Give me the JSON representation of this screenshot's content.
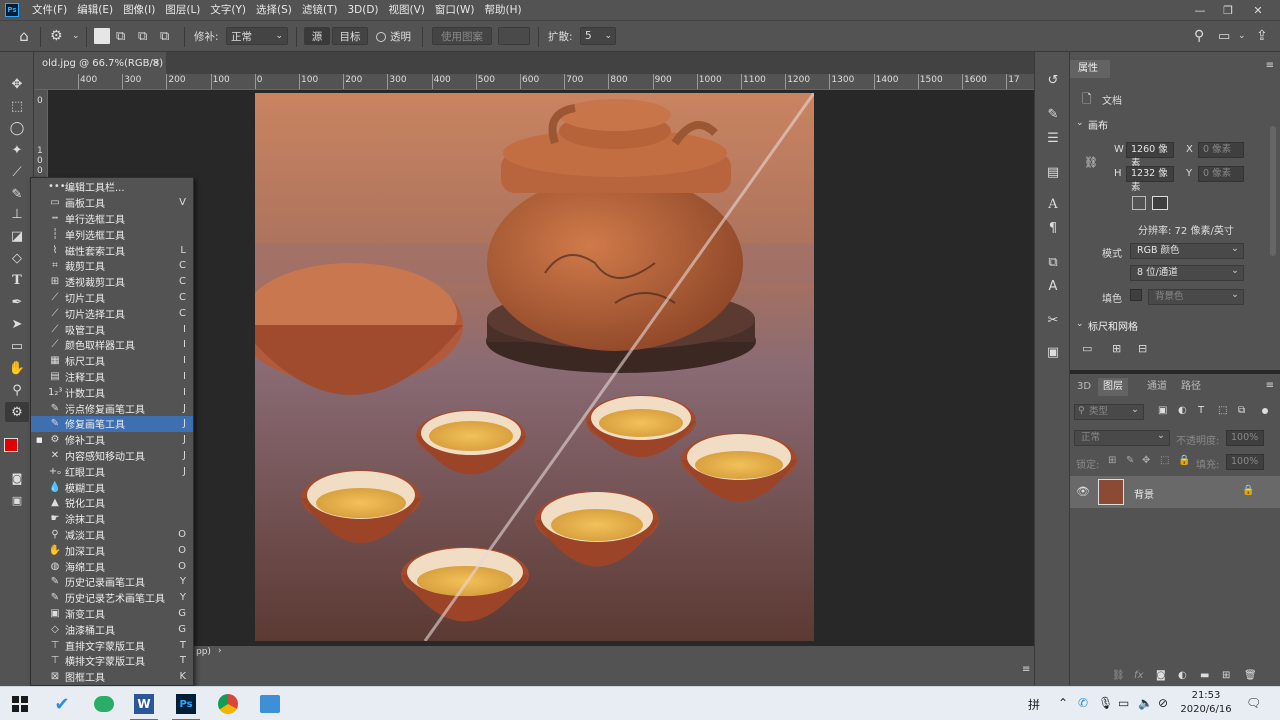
{
  "menubar": {
    "logo": "Ps",
    "items": [
      "文件(F)",
      "编辑(E)",
      "图像(I)",
      "图层(L)",
      "文字(Y)",
      "选择(S)",
      "滤镜(T)",
      "3D(D)",
      "视图(V)",
      "窗口(W)",
      "帮助(H)"
    ]
  },
  "options": {
    "patch_label": "修补:",
    "patch_mode": "正常",
    "source_label": "源",
    "target_label": "目标",
    "transparent_label": "透明",
    "use_pattern_label": "使用图案",
    "diffusion_label": "扩散:",
    "diffusion_value": "5"
  },
  "document": {
    "tab_title": "old.jpg @ 66.7%(RGB/8)",
    "zoom_status": "pp)"
  },
  "ruler": {
    "h_labels": [
      "400",
      "300",
      "200",
      "100",
      "0",
      "100",
      "200",
      "300",
      "400",
      "500",
      "600",
      "700",
      "800",
      "900",
      "1000",
      "1100",
      "1200",
      "1300",
      "1400",
      "1500",
      "1600",
      "17"
    ],
    "v_labels": [
      "0",
      "1",
      "0",
      "0"
    ]
  },
  "tool_flyout": {
    "items": [
      {
        "label": "编辑工具栏...",
        "key": "",
        "icon": "•••"
      },
      {
        "label": "画板工具",
        "key": "V",
        "icon": "▭"
      },
      {
        "label": "单行选框工具",
        "key": "",
        "icon": "┅"
      },
      {
        "label": "单列选框工具",
        "key": "",
        "icon": "┆"
      },
      {
        "label": "磁性套索工具",
        "key": "L",
        "icon": "⌇"
      },
      {
        "label": "裁剪工具",
        "key": "C",
        "icon": "⌗"
      },
      {
        "label": "透视裁剪工具",
        "key": "C",
        "icon": "⊞"
      },
      {
        "label": "切片工具",
        "key": "C",
        "icon": "⟋"
      },
      {
        "label": "切片选择工具",
        "key": "C",
        "icon": "⟋"
      },
      {
        "label": "吸管工具",
        "key": "I",
        "icon": "⟋"
      },
      {
        "label": "颜色取样器工具",
        "key": "I",
        "icon": "⟋"
      },
      {
        "label": "标尺工具",
        "key": "I",
        "icon": "▦"
      },
      {
        "label": "注释工具",
        "key": "I",
        "icon": "▤"
      },
      {
        "label": "计数工具",
        "key": "I",
        "icon": "1₂³"
      },
      {
        "label": "污点修复画笔工具",
        "key": "J",
        "icon": "✎"
      },
      {
        "label": "修复画笔工具",
        "key": "J",
        "icon": "✎"
      },
      {
        "label": "修补工具",
        "key": "J",
        "icon": "⚙"
      },
      {
        "label": "内容感知移动工具",
        "key": "J",
        "icon": "✕"
      },
      {
        "label": "红眼工具",
        "key": "J",
        "icon": "+ₒ"
      },
      {
        "label": "模糊工具",
        "key": "",
        "icon": "💧"
      },
      {
        "label": "锐化工具",
        "key": "",
        "icon": "▲"
      },
      {
        "label": "涂抹工具",
        "key": "",
        "icon": "☛"
      },
      {
        "label": "减淡工具",
        "key": "O",
        "icon": "⚲"
      },
      {
        "label": "加深工具",
        "key": "O",
        "icon": "✋"
      },
      {
        "label": "海绵工具",
        "key": "O",
        "icon": "◍"
      },
      {
        "label": "历史记录画笔工具",
        "key": "Y",
        "icon": "✎"
      },
      {
        "label": "历史记录艺术画笔工具",
        "key": "Y",
        "icon": "✎"
      },
      {
        "label": "渐变工具",
        "key": "G",
        "icon": "▣"
      },
      {
        "label": "油漆桶工具",
        "key": "G",
        "icon": "◇"
      },
      {
        "label": "直排文字蒙版工具",
        "key": "T",
        "icon": "⊤"
      },
      {
        "label": "横排文字蒙版工具",
        "key": "T",
        "icon": "⊤"
      },
      {
        "label": "图框工具",
        "key": "K",
        "icon": "⊠"
      }
    ]
  },
  "properties": {
    "panel_title": "属性",
    "doc_label": "文档",
    "canvas_section": "画布",
    "w_label": "W",
    "w_value": "1260 像素",
    "h_label": "H",
    "h_value": "1232 像素",
    "x_label": "X",
    "x_placeholder": "0 像素",
    "y_label": "Y",
    "y_placeholder": "0 像素",
    "resolution": "分辨率: 72 像素/英寸",
    "mode_label": "模式",
    "mode_value": "RGB 颜色",
    "depth_value": "8 位/通道",
    "fill_label": "填色",
    "fill_value": "背景色",
    "rulers_section": "标尺和网格"
  },
  "layers": {
    "tabs": [
      "3D",
      "图层",
      "通道",
      "路径"
    ],
    "active_tab": "图层",
    "filter_label": "类型",
    "blend_mode": "正常",
    "opacity_label": "不透明度:",
    "opacity_value": "100%",
    "lock_label": "锁定:",
    "fill_label": "填充:",
    "fill_value": "100%",
    "layer_name": "背景"
  },
  "taskbar": {
    "ime": "拼",
    "time": "21:53",
    "date": "2020/6/16"
  }
}
